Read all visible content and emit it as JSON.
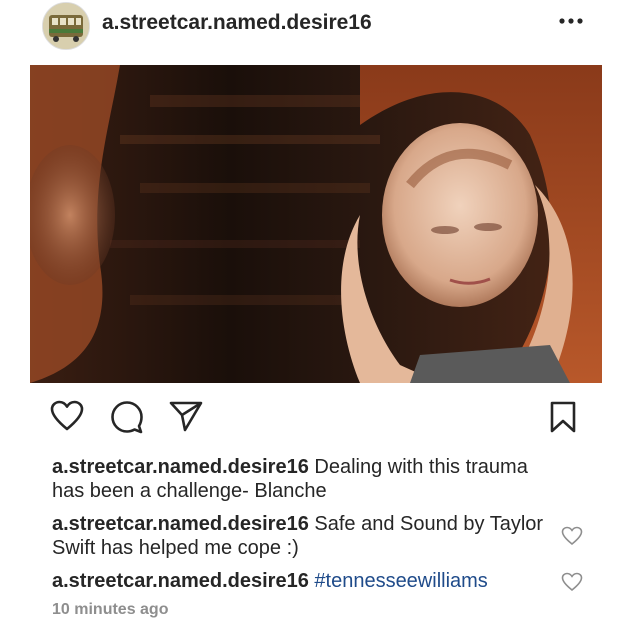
{
  "post": {
    "username": "a.streetcar.named.desire16",
    "timestamp": "10 minutes ago"
  },
  "actions": {
    "like": "heart-icon",
    "comment": "comment-icon",
    "share": "share-icon",
    "save": "bookmark-icon",
    "more": "more-options-icon"
  },
  "comments": [
    {
      "username": "a.streetcar.named.desire16",
      "text": "Dealing with this trauma has been a challenge- Blanche",
      "hashtag": ""
    },
    {
      "username": "a.streetcar.named.desire16",
      "text": "Safe and Sound by Taylor Swift has helped me cope :)",
      "hashtag": ""
    },
    {
      "username": "a.streetcar.named.desire16",
      "text": "",
      "hashtag": "#tennesseewilliams"
    }
  ],
  "colors": {
    "text": "#262626",
    "muted": "#8e8e8e",
    "hashtag": "#1f4b8a",
    "background": "#ffffff"
  }
}
